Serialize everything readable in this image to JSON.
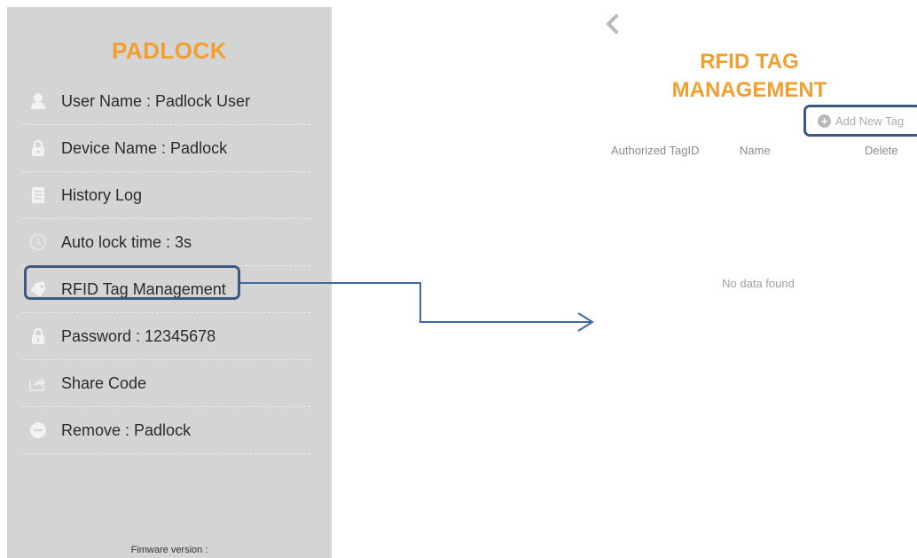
{
  "menu": {
    "title": "PADLOCK",
    "items": [
      {
        "icon": "user-icon",
        "label": "User Name : Padlock User"
      },
      {
        "icon": "padlock-icon",
        "label": "Device Name : Padlock"
      },
      {
        "icon": "document-icon",
        "label": "History Log"
      },
      {
        "icon": "clock-icon",
        "label": "Auto lock time : 3s"
      },
      {
        "icon": "tag-icon",
        "label": "RFID Tag Management"
      },
      {
        "icon": "lock-icon",
        "label": "Password : 12345678"
      },
      {
        "icon": "share-icon",
        "label": "Share Code"
      },
      {
        "icon": "minus-circle-icon",
        "label": "Remove : Padlock"
      }
    ],
    "firmware_label": "Fimware version :"
  },
  "rfid": {
    "title_line1": "RFID TAG",
    "title_line2": "MANAGEMENT",
    "add_label": "Add New Tag",
    "columns": [
      "Authorized TagID",
      "Name",
      "Delete"
    ],
    "empty_message": "No data found"
  },
  "colors": {
    "accent": "#f0a030",
    "highlight": "#3c5a80",
    "panel_bg": "#d4d4d4"
  }
}
